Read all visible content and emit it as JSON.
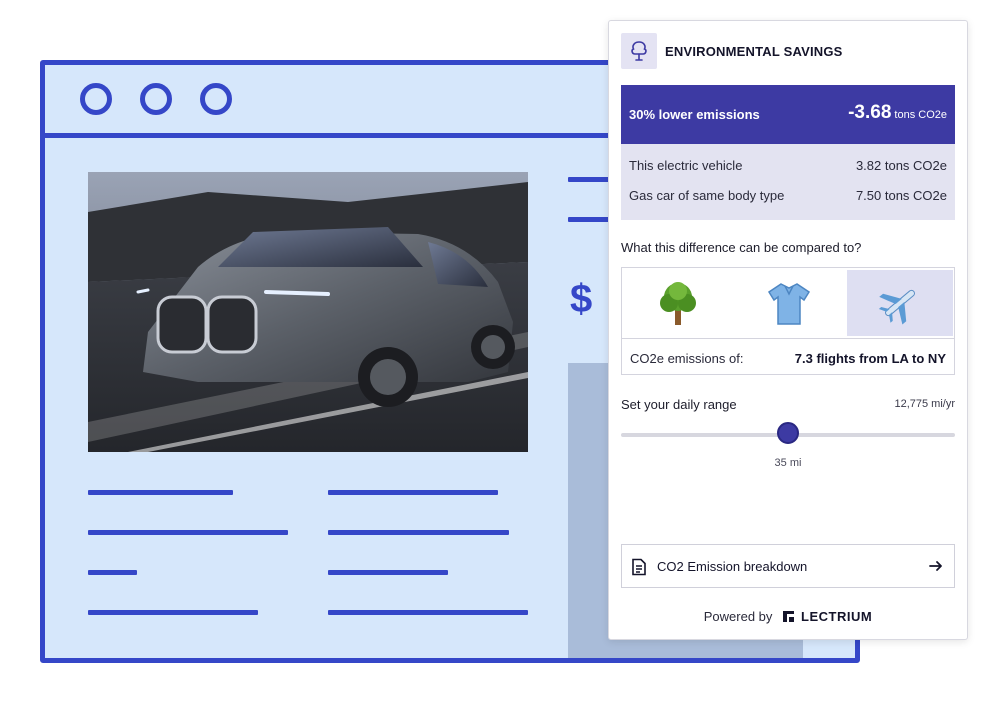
{
  "panel": {
    "title": "ENVIRONMENTAL SAVINGS",
    "header_icon": "tree-outline-icon",
    "banner": {
      "label": "30% lower emissions",
      "value": "-3.68",
      "unit": "tons CO2e"
    },
    "comparison": [
      {
        "label": "This electric vehicle",
        "value": "3.82 tons CO2e"
      },
      {
        "label": "Gas car of same body type",
        "value": "7.50 tons CO2e"
      }
    ],
    "question": "What this difference can be compared to?",
    "equivalents": {
      "options": [
        {
          "name": "tree-icon",
          "selected": false
        },
        {
          "name": "shirt-icon",
          "selected": false
        },
        {
          "name": "airplane-icon",
          "selected": true
        }
      ],
      "label": "CO2e emissions of:",
      "value": "7.3 flights from LA to NY"
    },
    "range": {
      "title": "Set your daily range",
      "annual": "12,775 mi/yr",
      "value_label": "35 mi",
      "fraction": 0.5
    },
    "breakdown_button": "CO2 Emission breakdown",
    "powered_by": "Powered by",
    "brand": "LECTRIUM"
  },
  "colors": {
    "accent": "#3d3aa3",
    "mockup_blue": "#3547c8",
    "mockup_bg": "#d6e7fb"
  }
}
